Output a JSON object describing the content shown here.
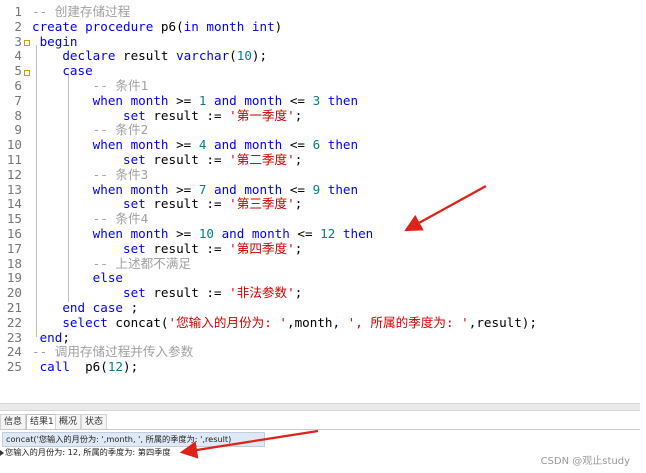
{
  "code_lines": [
    {
      "num": "1",
      "tokens": [
        {
          "t": "-- 创建存储过程",
          "c": "cm"
        }
      ]
    },
    {
      "num": "2",
      "tokens": [
        {
          "t": "create procedure",
          "c": "kw"
        },
        {
          "t": " p6(",
          "c": "op"
        },
        {
          "t": "in month int",
          "c": "kw"
        },
        {
          "t": ")",
          "c": "op"
        }
      ]
    },
    {
      "num": "3",
      "tokens": [
        {
          "t": " begin",
          "c": "kw"
        }
      ]
    },
    {
      "num": "4",
      "tokens": [
        {
          "t": "    declare",
          "c": "kw"
        },
        {
          "t": " result ",
          "c": "op"
        },
        {
          "t": "varchar",
          "c": "kw"
        },
        {
          "t": "(",
          "c": "op"
        },
        {
          "t": "10",
          "c": "num"
        },
        {
          "t": ");",
          "c": "op"
        }
      ]
    },
    {
      "num": "5",
      "tokens": [
        {
          "t": "    case",
          "c": "kw"
        }
      ]
    },
    {
      "num": "6",
      "tokens": [
        {
          "t": "        -- 条件1",
          "c": "cm"
        }
      ]
    },
    {
      "num": "7",
      "tokens": [
        {
          "t": "        when month",
          "c": "kw"
        },
        {
          "t": " >= ",
          "c": "op"
        },
        {
          "t": "1",
          "c": "num"
        },
        {
          "t": " and month",
          "c": "kw"
        },
        {
          "t": " <= ",
          "c": "op"
        },
        {
          "t": "3",
          "c": "num"
        },
        {
          "t": " then",
          "c": "kw"
        }
      ]
    },
    {
      "num": "8",
      "tokens": [
        {
          "t": "            set",
          "c": "kw"
        },
        {
          "t": " result := ",
          "c": "op"
        },
        {
          "t": "'第一季度'",
          "c": "str"
        },
        {
          "t": ";",
          "c": "op"
        }
      ]
    },
    {
      "num": "9",
      "tokens": [
        {
          "t": "        -- 条件2",
          "c": "cm"
        }
      ]
    },
    {
      "num": "10",
      "tokens": [
        {
          "t": "        when month",
          "c": "kw"
        },
        {
          "t": " >= ",
          "c": "op"
        },
        {
          "t": "4",
          "c": "num"
        },
        {
          "t": " and month",
          "c": "kw"
        },
        {
          "t": " <= ",
          "c": "op"
        },
        {
          "t": "6",
          "c": "num"
        },
        {
          "t": " then",
          "c": "kw"
        }
      ]
    },
    {
      "num": "11",
      "tokens": [
        {
          "t": "            set",
          "c": "kw"
        },
        {
          "t": " result := ",
          "c": "op"
        },
        {
          "t": "'第二季度'",
          "c": "str"
        },
        {
          "t": ";",
          "c": "op"
        }
      ]
    },
    {
      "num": "12",
      "tokens": [
        {
          "t": "        -- 条件3",
          "c": "cm"
        }
      ]
    },
    {
      "num": "13",
      "tokens": [
        {
          "t": "        when month",
          "c": "kw"
        },
        {
          "t": " >= ",
          "c": "op"
        },
        {
          "t": "7",
          "c": "num"
        },
        {
          "t": " and month",
          "c": "kw"
        },
        {
          "t": " <= ",
          "c": "op"
        },
        {
          "t": "9",
          "c": "num"
        },
        {
          "t": " then",
          "c": "kw"
        }
      ]
    },
    {
      "num": "14",
      "tokens": [
        {
          "t": "            set",
          "c": "kw"
        },
        {
          "t": " result := ",
          "c": "op"
        },
        {
          "t": "'第三季度'",
          "c": "str"
        },
        {
          "t": ";",
          "c": "op"
        }
      ]
    },
    {
      "num": "15",
      "tokens": [
        {
          "t": "        -- 条件4",
          "c": "cm"
        }
      ]
    },
    {
      "num": "16",
      "tokens": [
        {
          "t": "        when month",
          "c": "kw"
        },
        {
          "t": " >= ",
          "c": "op"
        },
        {
          "t": "10",
          "c": "num"
        },
        {
          "t": " and month",
          "c": "kw"
        },
        {
          "t": " <= ",
          "c": "op"
        },
        {
          "t": "12",
          "c": "num"
        },
        {
          "t": " then",
          "c": "kw"
        }
      ]
    },
    {
      "num": "17",
      "tokens": [
        {
          "t": "            set",
          "c": "kw"
        },
        {
          "t": " result := ",
          "c": "op"
        },
        {
          "t": "'第四季度'",
          "c": "str"
        },
        {
          "t": ";",
          "c": "op"
        }
      ]
    },
    {
      "num": "18",
      "tokens": [
        {
          "t": "        -- 上述都不满足",
          "c": "cm"
        }
      ]
    },
    {
      "num": "19",
      "tokens": [
        {
          "t": "        else",
          "c": "kw"
        }
      ]
    },
    {
      "num": "20",
      "tokens": [
        {
          "t": "            set",
          "c": "kw"
        },
        {
          "t": " result := ",
          "c": "op"
        },
        {
          "t": "'非法参数'",
          "c": "str"
        },
        {
          "t": ";",
          "c": "op"
        }
      ]
    },
    {
      "num": "21",
      "tokens": [
        {
          "t": "    end case",
          "c": "kw"
        },
        {
          "t": " ;",
          "c": "op"
        }
      ]
    },
    {
      "num": "22",
      "tokens": [
        {
          "t": "    select",
          "c": "kw"
        },
        {
          "t": " concat(",
          "c": "op"
        },
        {
          "t": "'您输入的月份为: '",
          "c": "str"
        },
        {
          "t": ",month, ",
          "c": "op"
        },
        {
          "t": "', 所属的季度为: '",
          "c": "str"
        },
        {
          "t": ",result);",
          "c": "op"
        }
      ]
    },
    {
      "num": "23",
      "tokens": [
        {
          "t": " end",
          "c": "kw"
        },
        {
          "t": ";",
          "c": "op"
        }
      ]
    },
    {
      "num": "24",
      "tokens": [
        {
          "t": "-- 调用存储过程并传入参数",
          "c": "cm"
        }
      ]
    },
    {
      "num": "25",
      "tokens": [
        {
          "t": " call",
          "c": "kw"
        },
        {
          "t": "  p6(",
          "c": "op"
        },
        {
          "t": "12",
          "c": "num"
        },
        {
          "t": ");",
          "c": "op"
        }
      ]
    }
  ],
  "tabs": [
    {
      "label": "信息",
      "active": false
    },
    {
      "label": "结果1",
      "active": true
    },
    {
      "label": "概况",
      "active": false
    },
    {
      "label": "状态",
      "active": false
    }
  ],
  "result": {
    "header": "concat('您输入的月份为: ',month, ', 所属的季度为: ',result)",
    "row": "您输入的月份为: 12, 所属的季度为: 第四季度"
  },
  "watermark": "CSDN @观止study",
  "colors": {
    "keyword": "#0000ff",
    "comment": "#a0a0a0",
    "string": "#d40000",
    "number": "#008080",
    "arrow": "#e0201b"
  }
}
